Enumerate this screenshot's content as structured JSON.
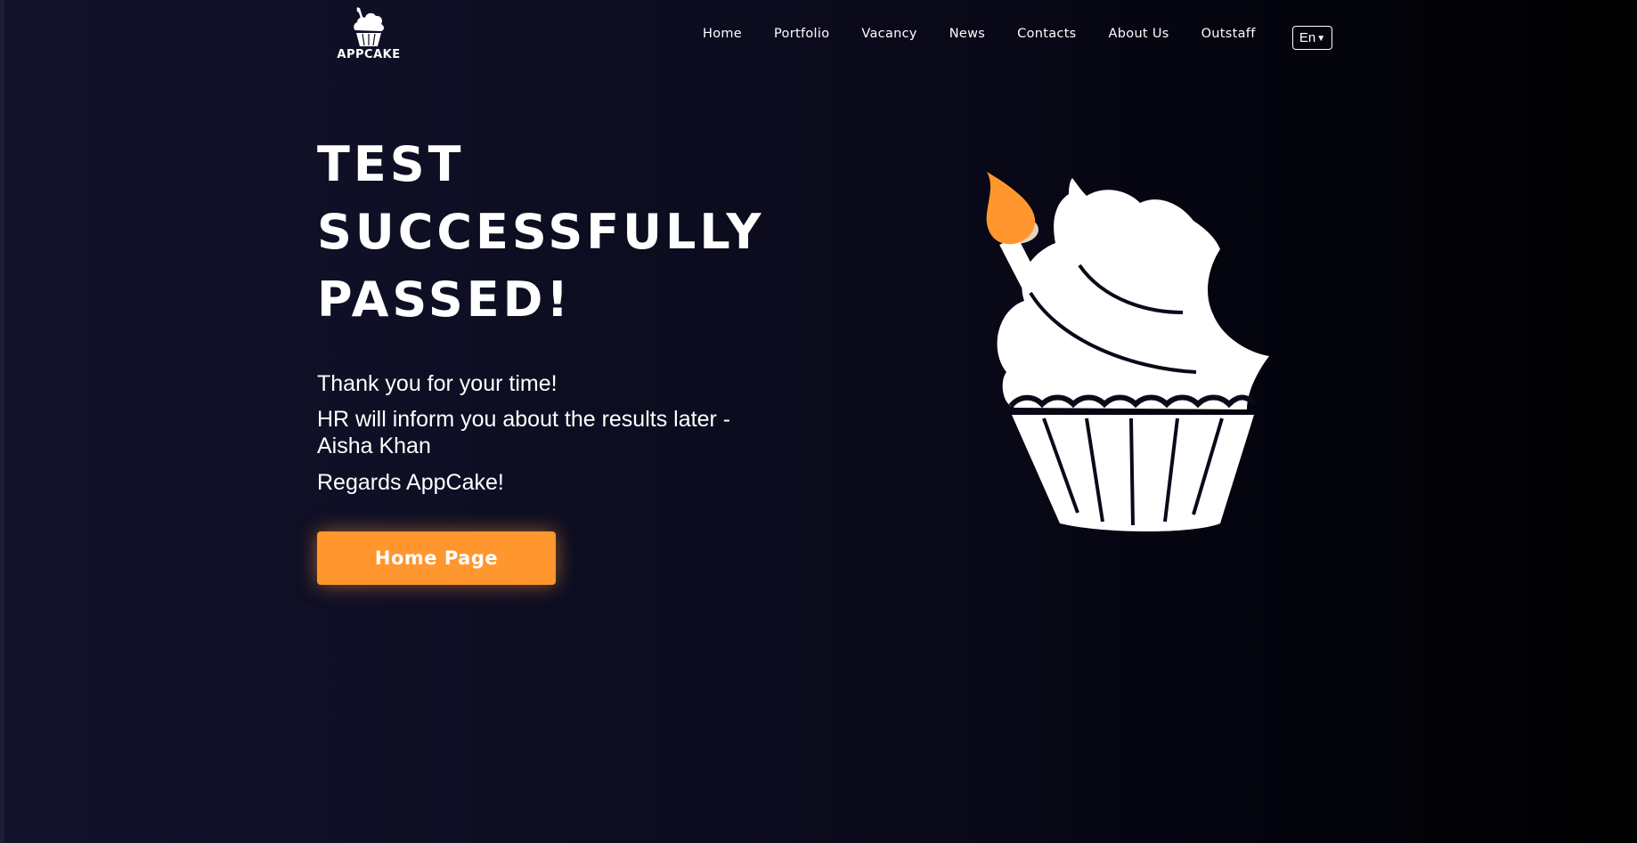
{
  "brand": {
    "name": "APPCAKE",
    "logo_icon": "cupcake-icon"
  },
  "nav": {
    "items": [
      "Home",
      "Portfolio",
      "Vacancy",
      "News",
      "Contacts",
      "About Us",
      "Outstaff"
    ]
  },
  "language": {
    "selected": "En",
    "icon": "caret-down-icon"
  },
  "main": {
    "headline_lines": [
      "TEST",
      "SUCCESSFULLY",
      "PASSED!"
    ],
    "message_1": "Thank you for your time!",
    "message_2": "HR will inform you about the results later - Aisha Khan",
    "message_3": "Regards AppCake!",
    "button_label": "Home Page",
    "illustration": "cupcake-with-candle-icon"
  },
  "colors": {
    "accent": "#ff962e",
    "background_dark": "#000000",
    "background_navy": "#12122b",
    "text": "#ffffff"
  }
}
